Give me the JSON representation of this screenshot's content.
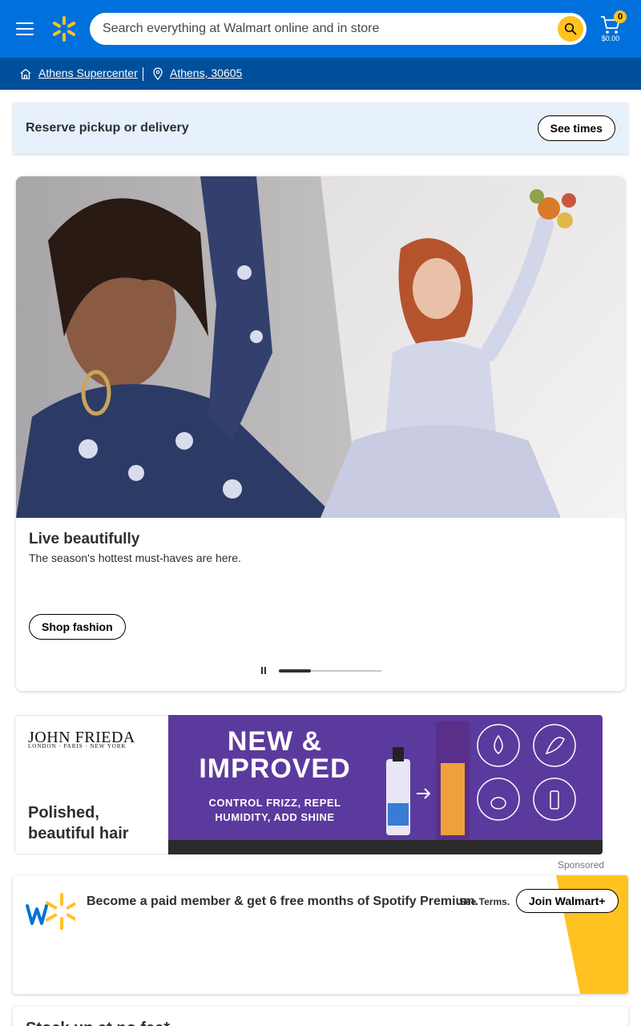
{
  "header": {
    "search_placeholder": "Search everything at Walmart online and in store",
    "cart_count": "0",
    "cart_total": "$0.00",
    "brand_color": "#0071dc",
    "accent_color": "#ffc220"
  },
  "store_bar": {
    "store_name": "Athens Supercenter",
    "location": "Athens, 30605"
  },
  "reserve": {
    "label": "Reserve pickup or delivery",
    "button": "See times"
  },
  "hero": {
    "title": "Live beautifully",
    "subtitle": "The season's hottest must-haves are here.",
    "button": "Shop fashion",
    "carousel_progress": 0.31
  },
  "sponsored_banner": {
    "brand": "JOHN FRIEDA",
    "brand_sub": "LONDON · PARIS · NEW YORK",
    "title": "Polished, beautiful hair",
    "headline_line1": "NEW &",
    "headline_line2": "IMPROVED",
    "tagline_line1": "CONTROL FRIZZ, REPEL",
    "tagline_line2": "HUMIDITY, ADD SHINE",
    "sponsored_label": "Sponsored"
  },
  "walmart_plus": {
    "text": "Become a paid member & get 6 free months of Spotify Premium.",
    "terms": "See Terms.",
    "button": "Join Walmart+"
  },
  "next_section": {
    "title": "Stock up at no fee*"
  }
}
